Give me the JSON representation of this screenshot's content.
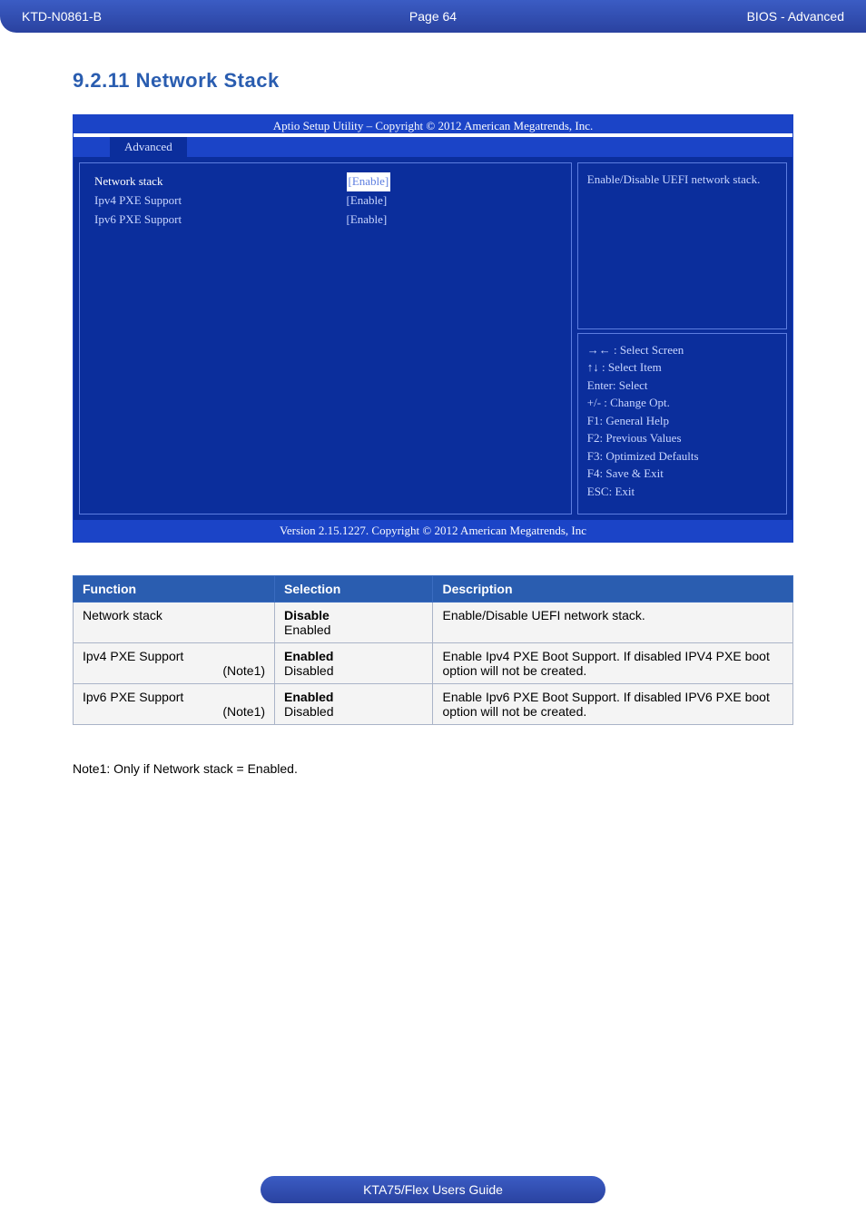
{
  "header": {
    "left": "KTD-N0861-B",
    "center": "Page 64",
    "right": "BIOS  - Advanced"
  },
  "section_title": "9.2.11  Network Stack",
  "bios": {
    "title": "Aptio Setup Utility  –  Copyright © 2012 American Megatrends, Inc.",
    "tab": "Advanced",
    "items": [
      {
        "label": "Network stack",
        "value": "[Enable]",
        "selected": true
      },
      {
        "label": "Ipv4 PXE Support",
        "value": "[Enable]",
        "selected": false
      },
      {
        "label": "Ipv6 PXE Support",
        "value": "[Enable]",
        "selected": false
      }
    ],
    "help_top": "Enable/Disable UEFI network stack.",
    "help_bottom": [
      "→← : Select Screen",
      "↑↓ : Select Item",
      "Enter: Select",
      "+/- : Change Opt.",
      "F1: General Help",
      "F2: Previous Values",
      "F3: Optimized Defaults",
      "F4: Save & Exit",
      "ESC: Exit"
    ],
    "footer": "Version 2.15.1227. Copyright © 2012 American Megatrends, Inc"
  },
  "table": {
    "headers": [
      "Function",
      "Selection",
      "Description"
    ],
    "rows": [
      {
        "function_main": "Network stack",
        "function_note": "",
        "selection_bold": "Disable",
        "selection_plain": "Enabled",
        "description": "Enable/Disable UEFI network stack."
      },
      {
        "function_main": "Ipv4 PXE Support",
        "function_note": "(Note1)",
        "selection_bold": "Enabled",
        "selection_plain": "Disabled",
        "description": "Enable Ipv4 PXE Boot Support. If disabled IPV4 PXE boot option will not be created."
      },
      {
        "function_main": "Ipv6 PXE Support",
        "function_note": "(Note1)",
        "selection_bold": "Enabled",
        "selection_plain": "Disabled",
        "description": "Enable Ipv6 PXE Boot Support. If disabled IPV6 PXE boot option will not be created."
      }
    ]
  },
  "note": "Note1: Only if Network stack = Enabled.",
  "footer": "KTA75/Flex Users Guide"
}
